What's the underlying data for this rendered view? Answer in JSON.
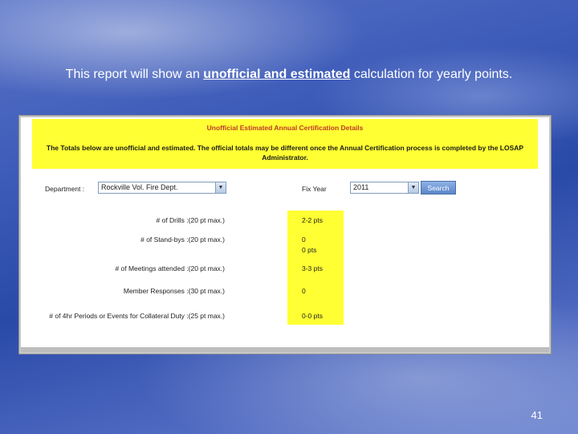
{
  "slide": {
    "headline_pre": "This report will show an ",
    "headline_emph": "unofficial and estimated",
    "headline_post": " calculation for yearly points.",
    "number": "41"
  },
  "report": {
    "title": "Unofficial Estimated Annual Certification Details",
    "notice": "The Totals below are unofficial and estimated. The official totals may be different once the Annual Certification process is completed by the LOSAP Administrator.",
    "department_label": "Department :",
    "department_value": "Rockville Vol. Fire Dept.",
    "year_label": "Fix Year",
    "year_value": "2011",
    "search_label": "Search",
    "rows": [
      {
        "label": "# of Drills :(20 pt max.)",
        "value": "2-2 pts"
      },
      {
        "label": "# of Stand-bys :(20 pt max.)",
        "value": "0",
        "value2": "0 pts"
      },
      {
        "label": "# of Meetings attended :(20 pt max.)",
        "value": "3-3 pts"
      },
      {
        "label": "Member Responses :(30 pt max.)",
        "value": "0"
      },
      {
        "label": "# of 4hr Periods or Events for Collateral Duty :(25 pt max.)",
        "value": "0-0 pts"
      }
    ]
  },
  "colors": {
    "highlight": "#ffff33",
    "title_red": "#c0392b"
  }
}
